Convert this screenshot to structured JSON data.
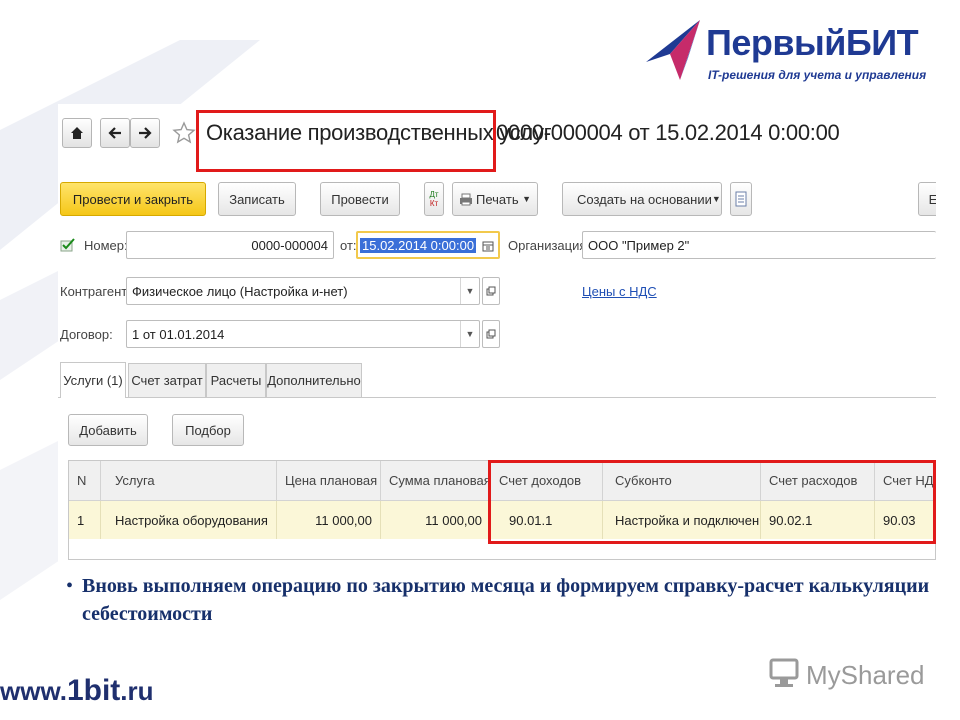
{
  "brand": {
    "name": "ПервыйБИТ",
    "tagline": "IT-решения для учета и управления",
    "url_prefix": "www.",
    "url_main": "1bit",
    "url_suffix": ".ru",
    "watermark": "MyShared"
  },
  "document": {
    "title_part1": "Оказание производственных услуг",
    "title_part2": "0000-000004 от 15.02.2014 0:00:00"
  },
  "toolbar": {
    "post_and_close": "Провести и закрыть",
    "save": "Записать",
    "post": "Провести",
    "dtkt_top": "Дт",
    "dtkt_bottom": "Кт",
    "print": "Печать",
    "create_based_on": "Создать на основании",
    "more": "Е"
  },
  "form": {
    "number_label": "Номер:",
    "number_value": "0000-000004",
    "date_label": "от:",
    "date_value": "15.02.2014  0:00:00",
    "organization_label": "Организация:",
    "organization_value": "ООО \"Пример 2\"",
    "counterparty_label": "Контрагент:",
    "counterparty_value": "Физическое лицо (Настройка и-нет)",
    "prices_link": "Цены с НДС",
    "contract_label": "Договор:",
    "contract_value": "1 от 01.01.2014"
  },
  "tabs": [
    "Услуги (1)",
    "Счет затрат",
    "Расчеты",
    "Дополнительно"
  ],
  "table_buttons": {
    "add": "Добавить",
    "select": "Подбор"
  },
  "table": {
    "columns": [
      "N",
      "Услуга",
      "Цена плановая",
      "Сумма плановая",
      "Счет доходов",
      "Субконто",
      "Счет расходов",
      "Счет НДС"
    ],
    "rows": [
      [
        "1",
        "Настройка оборудования",
        "11 000,00",
        "11 000,00",
        "90.01.1",
        "Настройка и подключен...",
        "90.02.1",
        "90.03"
      ]
    ]
  },
  "bullet": {
    "symbol": "•",
    "text": "Вновь выполняем операцию по закрытию месяца и формируем справку-расчет калькуляции себестоимости"
  },
  "colors": {
    "brand_blue": "#1f3a93",
    "highlight_red": "#e11a1a",
    "primary_button": "#f5c718",
    "row_highlight": "#fbf7d8"
  }
}
